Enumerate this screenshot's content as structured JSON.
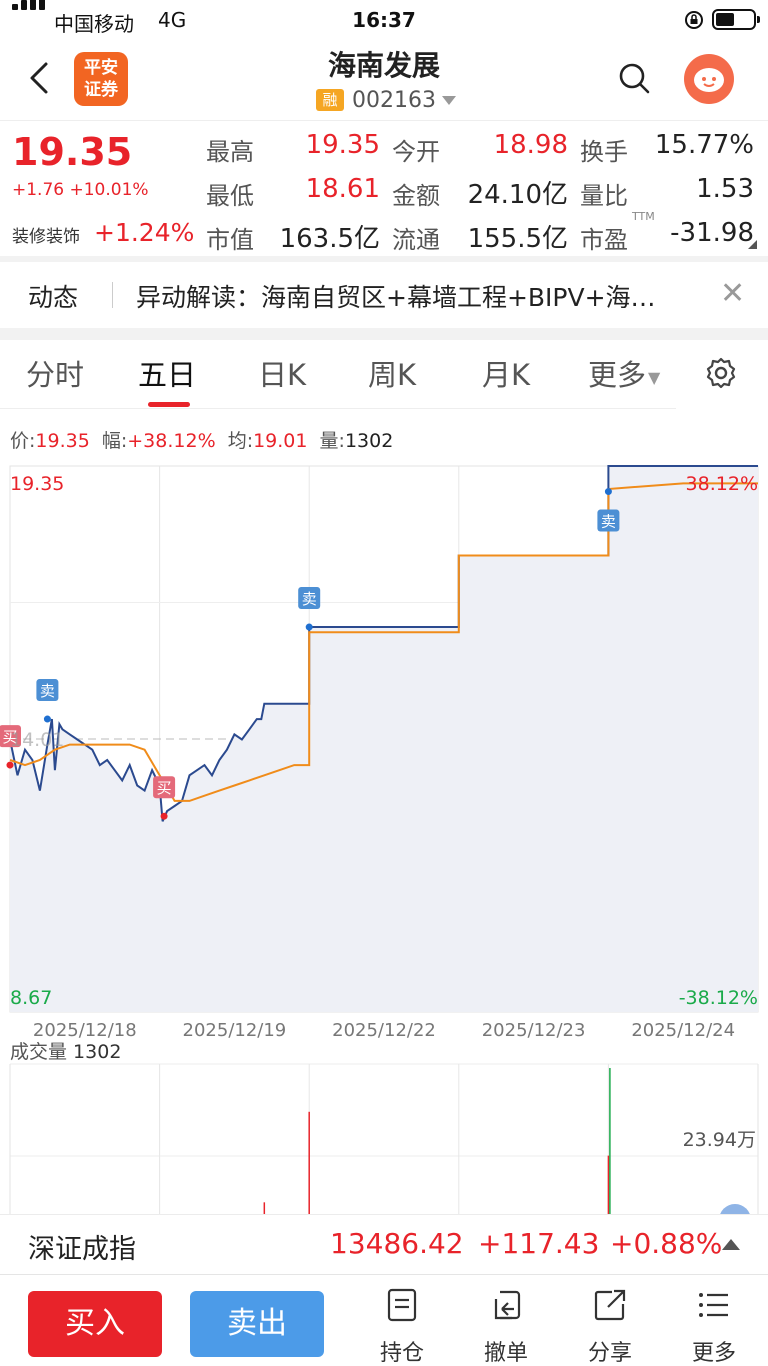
{
  "status_bar": {
    "carrier": "中国移动",
    "network": "4G",
    "time": "16:37"
  },
  "header": {
    "title": "海南发展",
    "margin_badge": "融",
    "stock_code": "002163",
    "logo_text": "平安证券"
  },
  "quote": {
    "price": "19.35",
    "change": "+1.76 +10.01%",
    "sector": "装修装饰",
    "sector_change": "+1.24%",
    "fields": [
      {
        "label": "最高",
        "value": "19.35",
        "tone": "red"
      },
      {
        "label": "今开",
        "value": "18.98",
        "tone": "red"
      },
      {
        "label": "换手",
        "value": "15.77%",
        "tone": "black"
      },
      {
        "label": "最低",
        "value": "18.61",
        "tone": "red"
      },
      {
        "label": "金额",
        "value": "24.10亿",
        "tone": "black"
      },
      {
        "label": "量比",
        "value": "1.53",
        "tone": "black"
      },
      {
        "label": "市值",
        "value": "163.5亿",
        "tone": "black"
      },
      {
        "label": "流通",
        "value": "155.5亿",
        "tone": "black"
      },
      {
        "label": "市盈",
        "value": "-31.98",
        "tone": "black"
      }
    ],
    "pe_sup": "TTM"
  },
  "news": {
    "tag": "动态",
    "text": "异动解读：海南自贸区+幕墙工程+BIPV+海…"
  },
  "tabs": {
    "t1": "分时",
    "t2": "五日",
    "t3": "日K",
    "t4": "周K",
    "t5": "月K",
    "t6": "更多"
  },
  "info_bar": {
    "price_label": "价:",
    "price": "19.35",
    "range_label": "幅:",
    "range": "+38.12%",
    "avg_label": "均:",
    "avg": "19.01",
    "vol_label": "量:",
    "vol": "1302"
  },
  "chart_data": {
    "type": "line",
    "x": [
      "2025/12/18",
      "2025/12/19",
      "2025/12/22",
      "2025/12/23",
      "2025/12/24"
    ],
    "y_max_label": "19.35",
    "y_min_label": "8.67",
    "pct_max_label": "38.12%",
    "pct_min_label": "-38.12%",
    "mid_label": "14.01",
    "ylim": [
      8.67,
      19.35
    ],
    "series": [
      {
        "color": "#2b4a8f",
        "points": [
          [
            0.0,
            14.0
          ],
          [
            0.05,
            13.3
          ],
          [
            0.1,
            13.8
          ],
          [
            0.15,
            13.6
          ],
          [
            0.2,
            13.0
          ],
          [
            0.25,
            13.9
          ],
          [
            0.28,
            14.4
          ],
          [
            0.3,
            13.4
          ],
          [
            0.33,
            14.3
          ],
          [
            0.35,
            14.2
          ],
          [
            0.4,
            14.1
          ],
          [
            0.45,
            14.0
          ],
          [
            0.5,
            13.9
          ],
          [
            0.55,
            13.8
          ],
          [
            0.6,
            13.5
          ],
          [
            0.65,
            13.6
          ],
          [
            0.7,
            13.4
          ],
          [
            0.75,
            13.2
          ],
          [
            0.8,
            13.5
          ],
          [
            0.85,
            13.1
          ],
          [
            0.9,
            13.0
          ],
          [
            0.95,
            13.4
          ],
          [
            1.0,
            13.1
          ],
          [
            1.02,
            12.4
          ],
          [
            1.05,
            12.6
          ],
          [
            1.1,
            12.7
          ],
          [
            1.15,
            12.8
          ],
          [
            1.2,
            13.3
          ],
          [
            1.25,
            13.4
          ],
          [
            1.3,
            13.5
          ],
          [
            1.35,
            13.3
          ],
          [
            1.4,
            13.6
          ],
          [
            1.45,
            13.8
          ],
          [
            1.5,
            14.1
          ],
          [
            1.55,
            14.0
          ],
          [
            1.6,
            14.2
          ],
          [
            1.65,
            14.4
          ],
          [
            1.68,
            14.4
          ],
          [
            1.7,
            14.7
          ],
          [
            1.75,
            14.7
          ],
          [
            1.8,
            14.7
          ],
          [
            1.85,
            14.7
          ],
          [
            1.9,
            14.7
          ],
          [
            1.95,
            14.7
          ],
          [
            2.0,
            14.7
          ],
          [
            2.0,
            16.2
          ],
          [
            2.5,
            16.2
          ],
          [
            3.0,
            16.2
          ],
          [
            3.0,
            17.6
          ],
          [
            3.5,
            17.6
          ],
          [
            4.0,
            17.6
          ],
          [
            4.0,
            19.35
          ],
          [
            4.5,
            19.35
          ],
          [
            5.0,
            19.35
          ]
        ]
      },
      {
        "color": "#f08c1a",
        "points": [
          [
            0.0,
            13.6
          ],
          [
            0.1,
            13.5
          ],
          [
            0.2,
            13.6
          ],
          [
            0.3,
            13.8
          ],
          [
            0.4,
            13.9
          ],
          [
            0.5,
            13.9
          ],
          [
            0.6,
            13.9
          ],
          [
            0.7,
            13.9
          ],
          [
            0.8,
            13.9
          ],
          [
            0.9,
            13.8
          ],
          [
            1.0,
            13.3
          ],
          [
            1.1,
            12.8
          ],
          [
            1.2,
            12.8
          ],
          [
            1.3,
            12.9
          ],
          [
            1.4,
            13.0
          ],
          [
            1.5,
            13.1
          ],
          [
            1.6,
            13.2
          ],
          [
            1.7,
            13.3
          ],
          [
            1.8,
            13.4
          ],
          [
            1.9,
            13.5
          ],
          [
            2.0,
            13.5
          ],
          [
            2.0,
            16.1
          ],
          [
            2.5,
            16.1
          ],
          [
            3.0,
            16.1
          ],
          [
            3.0,
            17.6
          ],
          [
            3.5,
            17.6
          ],
          [
            4.0,
            17.6
          ],
          [
            4.0,
            18.9
          ],
          [
            4.5,
            19.01
          ],
          [
            5.0,
            19.01
          ]
        ]
      }
    ],
    "markers": [
      {
        "label": "卖",
        "x": 0.25,
        "y": 14.4,
        "color": "#4c8fd4",
        "side": "above"
      },
      {
        "label": "卖",
        "x": 2.0,
        "y": 16.2,
        "color": "#4c8fd4",
        "side": "above"
      },
      {
        "label": "卖",
        "x": 4.0,
        "y": 18.85,
        "color": "#4c8fd4",
        "side": "below"
      },
      {
        "label": "买",
        "x": 0.0,
        "y": 13.5,
        "color": "#e46a7a",
        "side": "above"
      },
      {
        "label": "买",
        "x": 1.03,
        "y": 12.5,
        "color": "#e46a7a",
        "side": "above"
      }
    ]
  },
  "volume": {
    "label": "成交量",
    "value": "1302",
    "scale_label": "23.94万",
    "bars": [
      {
        "x": 2.0,
        "v": 0.7,
        "color": "#e8232a"
      },
      {
        "x": 1.7,
        "v": 0.08,
        "color": "#e8232a"
      },
      {
        "x": 4.0,
        "v": 0.4,
        "color": "#e8232a"
      },
      {
        "x": 4.01,
        "v": 1.0,
        "color": "#1aaa4a"
      }
    ]
  },
  "index": {
    "name": "深证成指",
    "value": "13486.42",
    "change": "+117.43",
    "pct": "+0.88%"
  },
  "bottom": {
    "buy": "买入",
    "sell": "卖出",
    "hold": "持仓",
    "cancel": "撤单",
    "share": "分享",
    "more": "更多"
  }
}
